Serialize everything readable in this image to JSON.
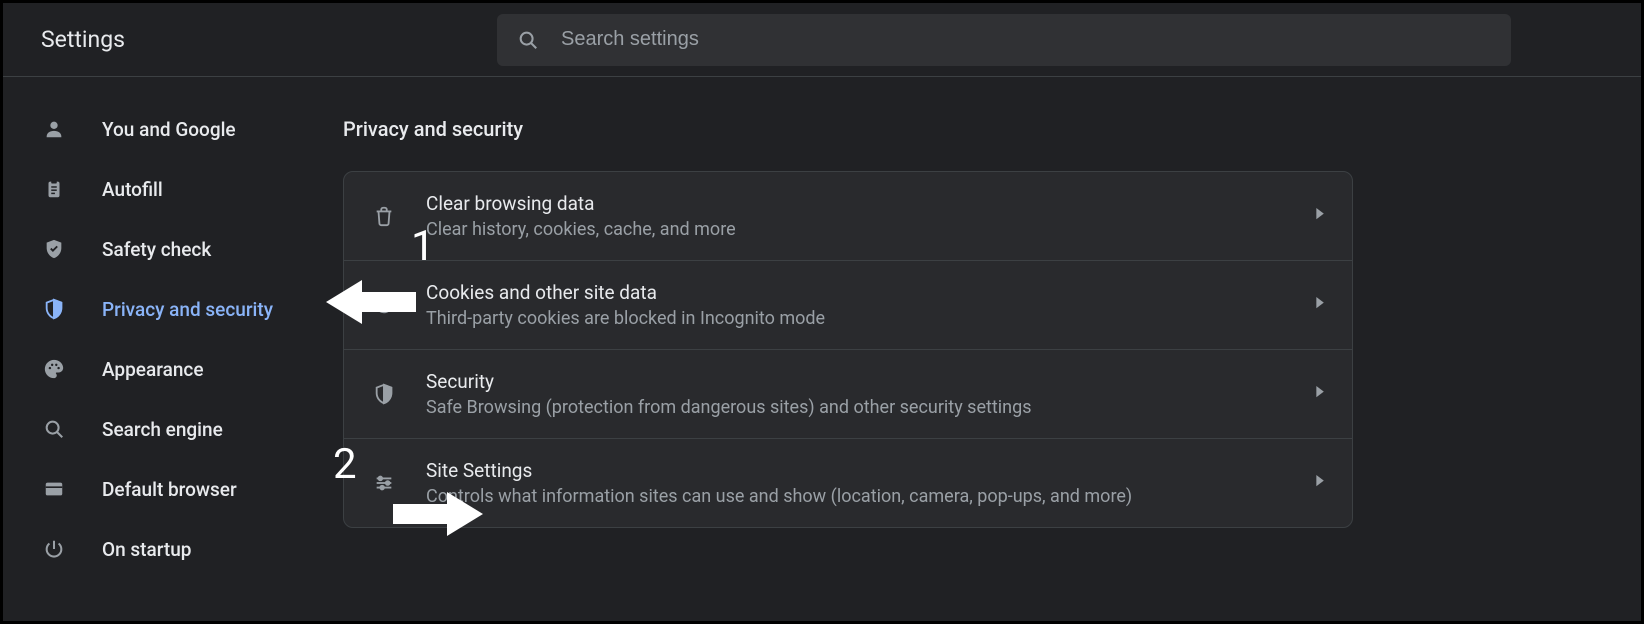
{
  "header": {
    "title": "Settings",
    "search_placeholder": "Search settings"
  },
  "sidebar": {
    "items": [
      {
        "label": "You and Google",
        "icon": "person"
      },
      {
        "label": "Autofill",
        "icon": "clipboard"
      },
      {
        "label": "Safety check",
        "icon": "shield-check"
      },
      {
        "label": "Privacy and security",
        "icon": "shield"
      },
      {
        "label": "Appearance",
        "icon": "palette"
      },
      {
        "label": "Search engine",
        "icon": "search"
      },
      {
        "label": "Default browser",
        "icon": "browser"
      },
      {
        "label": "On startup",
        "icon": "power"
      }
    ],
    "active_index": 3
  },
  "main": {
    "section_title": "Privacy and security",
    "rows": [
      {
        "title": "Clear browsing data",
        "sub": "Clear history, cookies, cache, and more",
        "icon": "trash"
      },
      {
        "title": "Cookies and other site data",
        "sub": "Third-party cookies are blocked in Incognito mode",
        "icon": "cookie"
      },
      {
        "title": "Security",
        "sub": "Safe Browsing (protection from dangerous sites) and other security settings",
        "icon": "shield-outline"
      },
      {
        "title": "Site Settings",
        "sub": "Controls what information sites can use and show (location, camera, pop-ups, and more)",
        "icon": "tune"
      }
    ]
  },
  "annotations": {
    "a1": "1",
    "a2": "2"
  }
}
